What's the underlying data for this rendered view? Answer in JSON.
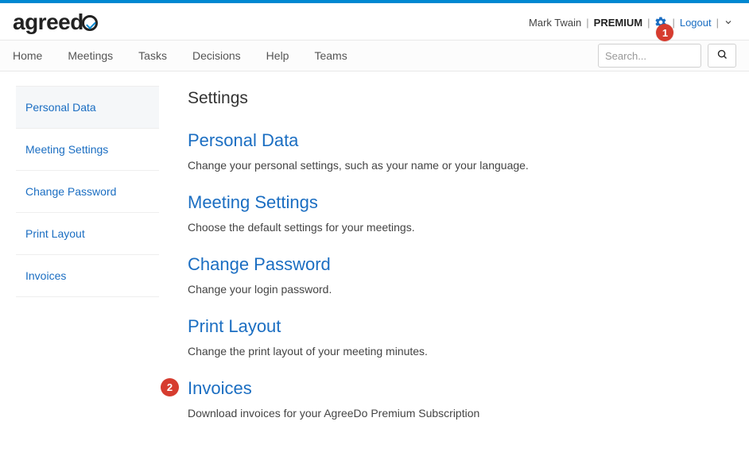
{
  "brand": "agreedo",
  "header": {
    "user_name": "Mark Twain",
    "plan": "PREMIUM",
    "logout_label": "Logout",
    "annotation_1": "1"
  },
  "nav": {
    "items": [
      {
        "label": "Home"
      },
      {
        "label": "Meetings"
      },
      {
        "label": "Tasks"
      },
      {
        "label": "Decisions"
      },
      {
        "label": "Help"
      },
      {
        "label": "Teams"
      }
    ],
    "search_placeholder": "Search..."
  },
  "sidebar": {
    "items": [
      {
        "label": "Personal Data",
        "active": true
      },
      {
        "label": "Meeting Settings"
      },
      {
        "label": "Change Password"
      },
      {
        "label": "Print Layout"
      },
      {
        "label": "Invoices"
      }
    ]
  },
  "main": {
    "title": "Settings",
    "sections": [
      {
        "heading": "Personal Data",
        "desc": "Change your personal settings, such as your name or your language."
      },
      {
        "heading": "Meeting Settings",
        "desc": "Choose the default settings for your meetings."
      },
      {
        "heading": "Change Password",
        "desc": "Change your login password."
      },
      {
        "heading": "Print Layout",
        "desc": "Change the print layout of your meeting minutes."
      },
      {
        "heading": "Invoices",
        "desc": "Download invoices for your AgreeDo Premium Subscription",
        "annotation": "2"
      }
    ]
  }
}
